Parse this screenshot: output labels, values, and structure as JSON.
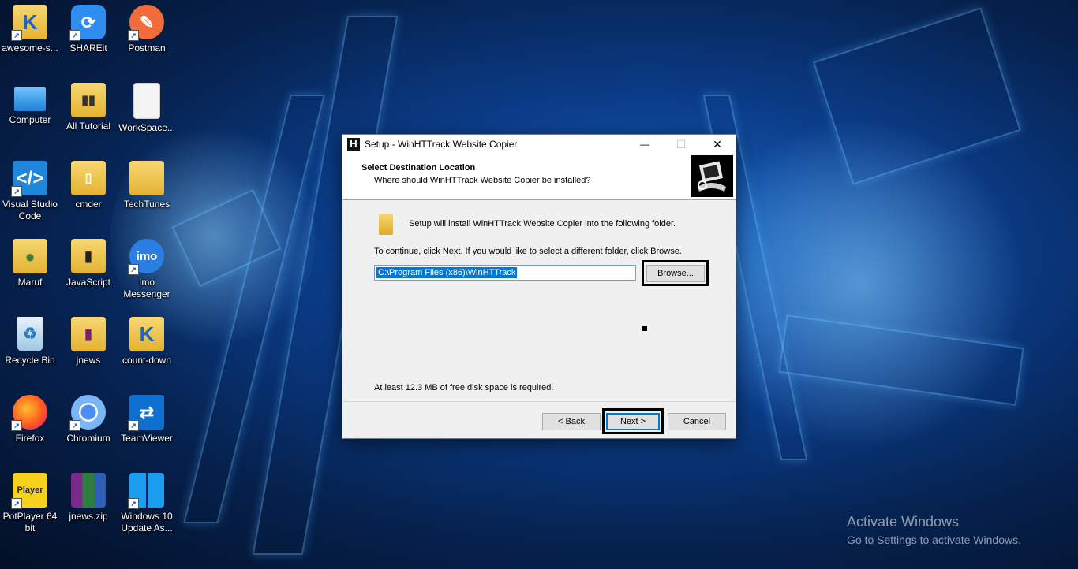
{
  "desktop": {
    "icons": [
      {
        "label": "awesome-s..."
      },
      {
        "label": "SHAREit"
      },
      {
        "label": "Postman"
      },
      {
        "label": "Computer"
      },
      {
        "label": "All Tutorial"
      },
      {
        "label": "WorkSpace..."
      },
      {
        "label": "Visual Studio Code"
      },
      {
        "label": "cmder"
      },
      {
        "label": "TechTunes"
      },
      {
        "label": "Maruf"
      },
      {
        "label": "JavaScript"
      },
      {
        "label": "Imo Messenger"
      },
      {
        "label": "Recycle Bin"
      },
      {
        "label": "jnews"
      },
      {
        "label": "count-down"
      },
      {
        "label": "Firefox"
      },
      {
        "label": "Chromium"
      },
      {
        "label": "TeamViewer"
      },
      {
        "label": "PotPlayer 64 bit"
      },
      {
        "label": "jnews.zip"
      },
      {
        "label": "Windows 10 Update As..."
      }
    ],
    "icon_glyphs": {
      "imo": "imo",
      "potplayer": "Player"
    }
  },
  "dialog": {
    "app_glyph": "H",
    "title": "Setup - WinHTTrack Website Copier",
    "header_title": "Select Destination Location",
    "header_subtitle": "Where should WinHTTrack Website Copier be installed?",
    "install_text": "Setup will install WinHTTrack Website Copier into the following folder.",
    "continue_text": "To continue, click Next. If you would like to select a different folder, click Browse.",
    "path_value": "C:\\Program Files (x86)\\WinHTTrack",
    "browse_label": "Browse...",
    "disk_space_text": "At least 12.3 MB of free disk space is required.",
    "back_label": "< Back",
    "next_label": "Next >",
    "cancel_label": "Cancel",
    "minimize_glyph": "—",
    "maximize_glyph": "☐",
    "close_glyph": "✕"
  },
  "watermark": {
    "line1": "Activate Windows",
    "line2": "Go to Settings to activate Windows."
  }
}
